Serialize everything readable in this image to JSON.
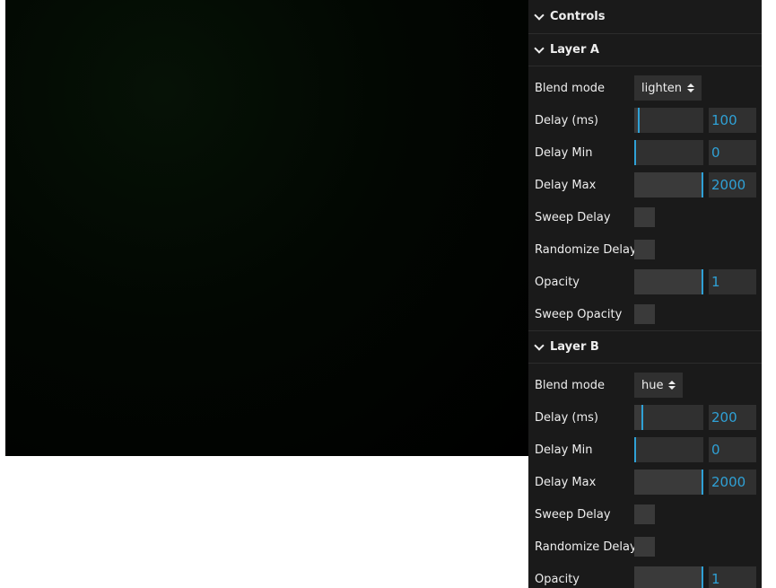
{
  "controls": {
    "title": "Controls"
  },
  "layers": [
    {
      "title": "Layer A",
      "blend": {
        "label": "Blend mode",
        "value": "lighten"
      },
      "delay": {
        "label": "Delay (ms)",
        "value": "100",
        "fraction": 0.05
      },
      "delay_min": {
        "label": "Delay Min",
        "value": "0",
        "fraction": 0.0
      },
      "delay_max": {
        "label": "Delay Max",
        "value": "2000",
        "fraction": 1.0
      },
      "sweep_delay": {
        "label": "Sweep Delay",
        "checked": false
      },
      "randomize_delay": {
        "label": "Randomize Delay",
        "checked": false
      },
      "opacity": {
        "label": "Opacity",
        "value": "1",
        "fraction": 1.0
      },
      "sweep_opacity": {
        "label": "Sweep Opacity",
        "checked": false
      }
    },
    {
      "title": "Layer B",
      "blend": {
        "label": "Blend mode",
        "value": "hue"
      },
      "delay": {
        "label": "Delay (ms)",
        "value": "200",
        "fraction": 0.1
      },
      "delay_min": {
        "label": "Delay Min",
        "value": "0",
        "fraction": 0.0
      },
      "delay_max": {
        "label": "Delay Max",
        "value": "2000",
        "fraction": 1.0
      },
      "sweep_delay": {
        "label": "Sweep Delay",
        "checked": false
      },
      "randomize_delay": {
        "label": "Randomize Delay",
        "checked": false
      },
      "opacity": {
        "label": "Opacity",
        "value": "1",
        "fraction": 1.0
      }
    }
  ],
  "colors": {
    "accent": "#2fa1d6",
    "panel_bg": "#1a1a1a",
    "control_bg": "#303030"
  },
  "icons": {
    "section_toggle": "chevron-down-icon",
    "select_arrows": "updown-arrows-icon"
  }
}
